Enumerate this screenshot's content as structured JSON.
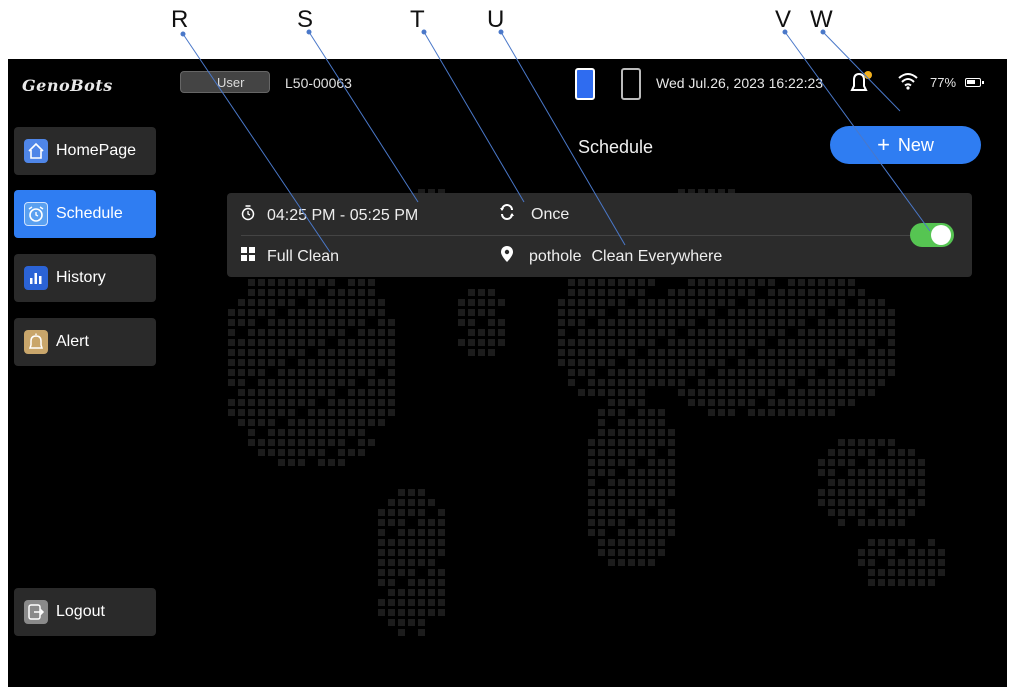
{
  "callouts": [
    "R",
    "S",
    "T",
    "U",
    "V",
    "W"
  ],
  "header": {
    "logo_text": "GenoBots",
    "user_label": "User",
    "device_id": "L50-00063",
    "datetime": "Wed Jul.26, 2023 16:22:23",
    "battery_percent": "77%"
  },
  "sidebar": {
    "items": [
      {
        "label": "HomePage",
        "icon": "home-icon",
        "active": false
      },
      {
        "label": "Schedule",
        "icon": "alarm-clock-icon",
        "active": true
      },
      {
        "label": "History",
        "icon": "bar-chart-icon",
        "active": false
      },
      {
        "label": "Alert",
        "icon": "alarm-bell-icon",
        "active": false
      }
    ],
    "logout_label": "Logout"
  },
  "main": {
    "title": "Schedule",
    "new_button_label": "New"
  },
  "schedule_card": {
    "time_range": "04:25 PM - 05:25 PM",
    "repeat": "Once",
    "mode": "Full Clean",
    "location": "pothole",
    "area": "Clean Everywhere",
    "enabled": true
  },
  "colors": {
    "accent": "#2f7df2",
    "toggle_on": "#56c552",
    "background": "#000000",
    "card": "#2b2b2b"
  }
}
